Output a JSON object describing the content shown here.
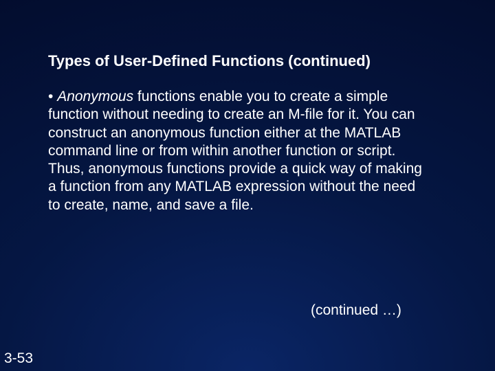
{
  "slide": {
    "title": "Types of User-Defined Functions (continued)",
    "bullet_marker": "•  ",
    "term_italic": "Anonymous",
    "body_rest": " functions enable you to create a simple function without needing to create   an M-file for it. You can construct an anonymous function either at the MATLAB command line or from within another function or script. Thus, anonymous functions  provide a quick way of making a function from any MATLAB expression without the  need to create, name, and save a file.",
    "continued": "(continued …)",
    "page": "3-53"
  }
}
